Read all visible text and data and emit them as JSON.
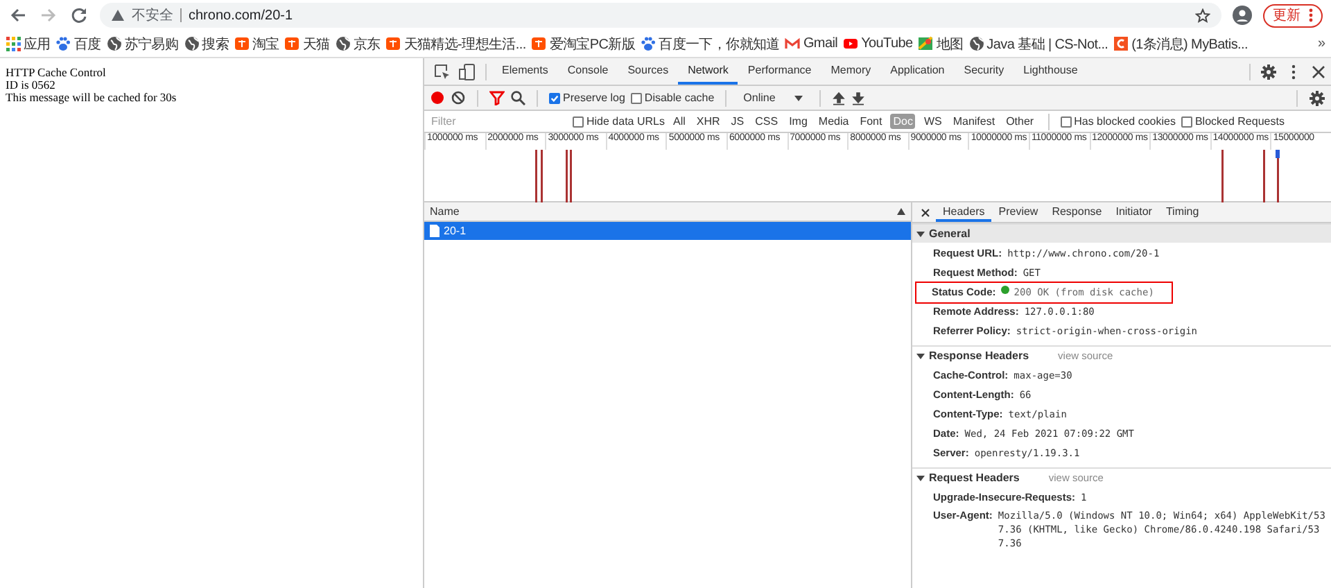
{
  "browser": {
    "security_label": "不安全",
    "url": "chrono.com/20-1",
    "update_button": "更新"
  },
  "bookmarks": [
    {
      "kind": "apps",
      "label": "应用"
    },
    {
      "kind": "paw",
      "label": "百度"
    },
    {
      "kind": "globe",
      "label": "苏宁易购"
    },
    {
      "kind": "globe",
      "label": "搜索"
    },
    {
      "kind": "orange",
      "label": "淘宝"
    },
    {
      "kind": "orange",
      "label": "天猫"
    },
    {
      "kind": "globe",
      "label": "京东"
    },
    {
      "kind": "orange",
      "label": "天猫精选-理想生活..."
    },
    {
      "kind": "orange",
      "label": "爱淘宝PC新版"
    },
    {
      "kind": "paw",
      "label": "百度一下，你就知道"
    },
    {
      "kind": "gmail",
      "label": "Gmail"
    },
    {
      "kind": "youtube",
      "label": "YouTube"
    },
    {
      "kind": "maps",
      "label": "地图"
    },
    {
      "kind": "globe",
      "label": "Java 基础 | CS-Not..."
    },
    {
      "kind": "csdn",
      "label": "(1条消息) MyBatis..."
    }
  ],
  "bookmarks_more": "»",
  "page_lines": [
    "HTTP Cache Control",
    "ID is 0562",
    "This message will be cached for 30s"
  ],
  "devtools": {
    "tabs": [
      {
        "label": "Elements",
        "selected": false
      },
      {
        "label": "Console",
        "selected": false
      },
      {
        "label": "Sources",
        "selected": false
      },
      {
        "label": "Network",
        "selected": true
      },
      {
        "label": "Performance",
        "selected": false
      },
      {
        "label": "Memory",
        "selected": false
      },
      {
        "label": "Application",
        "selected": false
      },
      {
        "label": "Security",
        "selected": false
      },
      {
        "label": "Lighthouse",
        "selected": false
      }
    ],
    "recording": true,
    "preserve_log": {
      "label": "Preserve log",
      "checked": true
    },
    "disable_cache": {
      "label": "Disable cache",
      "checked": false
    },
    "throttling": "Online",
    "filter": {
      "placeholder": "Filter"
    },
    "hide_data_urls": {
      "label": "Hide data URLs",
      "checked": false
    },
    "type_filters": [
      {
        "label": "All",
        "selected": false
      },
      {
        "label": "XHR",
        "selected": false
      },
      {
        "label": "JS",
        "selected": false
      },
      {
        "label": "CSS",
        "selected": false
      },
      {
        "label": "Img",
        "selected": false
      },
      {
        "label": "Media",
        "selected": false
      },
      {
        "label": "Font",
        "selected": false
      },
      {
        "label": "Doc",
        "selected": true
      },
      {
        "label": "WS",
        "selected": false
      },
      {
        "label": "Manifest",
        "selected": false
      },
      {
        "label": "Other",
        "selected": false
      }
    ],
    "has_blocked_cookies": {
      "label": "Has blocked cookies",
      "checked": false
    },
    "blocked_requests": {
      "label": "Blocked Requests",
      "checked": false
    },
    "timeline_ticks": [
      "1000000 ms",
      "2000000 ms",
      "3000000 ms",
      "4000000 ms",
      "5000000 ms",
      "6000000 ms",
      "7000000 ms",
      "8000000 ms",
      "9000000 ms",
      "10000000 ms",
      "11000000 ms",
      "12000000 ms",
      "13000000 ms",
      "14000000 ms",
      "15000000"
    ],
    "name_column": "Name",
    "requests": [
      {
        "name": "20-1",
        "selected": true
      }
    ],
    "detail_tabs": [
      {
        "label": "Headers",
        "selected": true
      },
      {
        "label": "Preview",
        "selected": false
      },
      {
        "label": "Response",
        "selected": false
      },
      {
        "label": "Initiator",
        "selected": false
      },
      {
        "label": "Timing",
        "selected": false
      }
    ],
    "sections": [
      {
        "title": "General",
        "expanded": true,
        "shaded": true,
        "rows": [
          {
            "kind": "plain",
            "key": "Request URL:",
            "value": "http://www.chrono.com/20-1",
            "highlighted": false
          },
          {
            "kind": "plain",
            "key": "Request Method:",
            "value": "GET",
            "highlighted": false
          },
          {
            "kind": "status",
            "key": "Status Code:",
            "value": "200 OK (from disk cache)",
            "highlighted": true
          },
          {
            "kind": "plain",
            "key": "Remote Address:",
            "value": "127.0.0.1:80",
            "highlighted": false
          },
          {
            "kind": "plain",
            "key": "Referrer Policy:",
            "value": "strict-origin-when-cross-origin",
            "highlighted": false
          }
        ]
      },
      {
        "title": "Response Headers",
        "link": "view source",
        "expanded": true,
        "shaded": false,
        "rows": [
          {
            "kind": "plain",
            "key": "Cache-Control:",
            "value": "max-age=30",
            "highlighted": false
          },
          {
            "kind": "plain",
            "key": "Content-Length:",
            "value": "66",
            "highlighted": false
          },
          {
            "kind": "plain",
            "key": "Content-Type:",
            "value": "text/plain",
            "highlighted": false
          },
          {
            "kind": "plain",
            "key": "Date:",
            "value": "Wed, 24 Feb 2021 07:09:22 GMT",
            "highlighted": false
          },
          {
            "kind": "plain",
            "key": "Server:",
            "value": "openresty/1.19.3.1",
            "highlighted": false
          }
        ]
      },
      {
        "title": "Request Headers",
        "link": "view source",
        "expanded": true,
        "shaded": false,
        "rows": [
          {
            "kind": "plain",
            "key": "Upgrade-Insecure-Requests:",
            "value": "1",
            "highlighted": false
          },
          {
            "kind": "plain",
            "key": "User-Agent:",
            "value": "Mozilla/5.0 (Windows NT 10.0; Win64; x64) AppleWebKit/537.36 (KHTML, like Gecko) Chrome/86.0.4240.198 Safari/537.36",
            "highlighted": false
          }
        ]
      }
    ]
  }
}
